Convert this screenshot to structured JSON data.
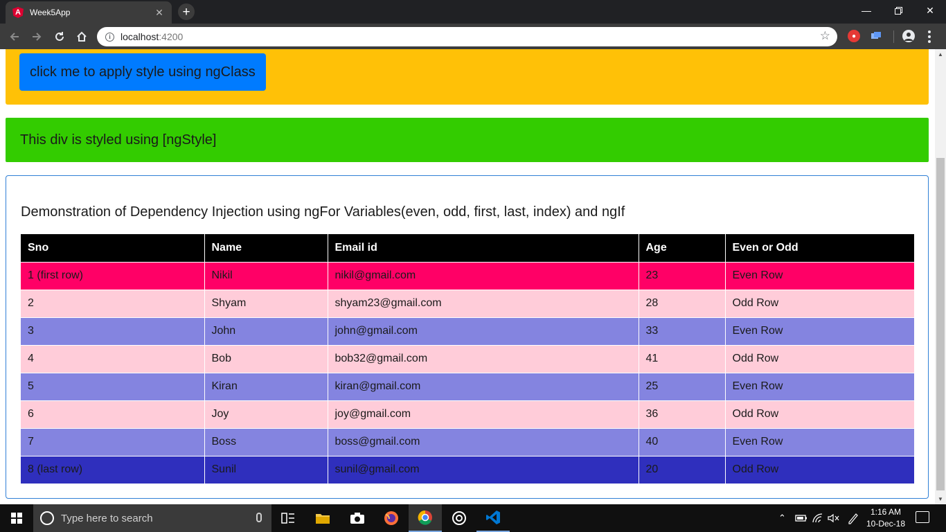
{
  "browser": {
    "tab_title": "Week5App",
    "tab_favicon_letter": "A",
    "url_host": "localhost",
    "url_port": ":4200"
  },
  "page": {
    "ngclass_button_label": "click me to apply style using ngClass",
    "ngstyle_text": "This div is styled using [ngStyle]",
    "card_title": "Demonstration of Dependency Injection using ngFor Variables(even, odd, first, last, index) and ngIf",
    "table": {
      "headers": [
        "Sno",
        "Name",
        "Email id",
        "Age",
        "Even or Odd"
      ],
      "rows": [
        {
          "sno": "1 (first row)",
          "name": "Nikil",
          "email": "nikil@gmail.com",
          "age": "23",
          "parity": "Even Row"
        },
        {
          "sno": "2",
          "name": "Shyam",
          "email": "shyam23@gmail.com",
          "age": "28",
          "parity": "Odd Row"
        },
        {
          "sno": "3",
          "name": "John",
          "email": "john@gmail.com",
          "age": "33",
          "parity": "Even Row"
        },
        {
          "sno": "4",
          "name": "Bob",
          "email": "bob32@gmail.com",
          "age": "41",
          "parity": "Odd Row"
        },
        {
          "sno": "5",
          "name": "Kiran",
          "email": "kiran@gmail.com",
          "age": "25",
          "parity": "Even Row"
        },
        {
          "sno": "6",
          "name": "Joy",
          "email": "joy@gmail.com",
          "age": "36",
          "parity": "Odd Row"
        },
        {
          "sno": "7",
          "name": "Boss",
          "email": "boss@gmail.com",
          "age": "40",
          "parity": "Even Row"
        },
        {
          "sno": "8 (last row)",
          "name": "Sunil",
          "email": "sunil@gmail.com",
          "age": "20",
          "parity": "Odd Row"
        }
      ]
    }
  },
  "taskbar": {
    "search_placeholder": "Type here to search",
    "time": "1:16 AM",
    "date": "10-Dec-18",
    "apps": [
      "task-view",
      "file-explorer",
      "camera",
      "firefox",
      "chrome",
      "groove-music",
      "vs-code"
    ]
  },
  "colors": {
    "yellow_panel": "#ffc107",
    "button_blue": "#007bff",
    "green_panel": "#33cc00",
    "first_row": "#ff0066",
    "even_row": "#8484e0",
    "odd_row": "#ffccd9",
    "last_row": "#2f2fbd",
    "header": "#000000"
  }
}
